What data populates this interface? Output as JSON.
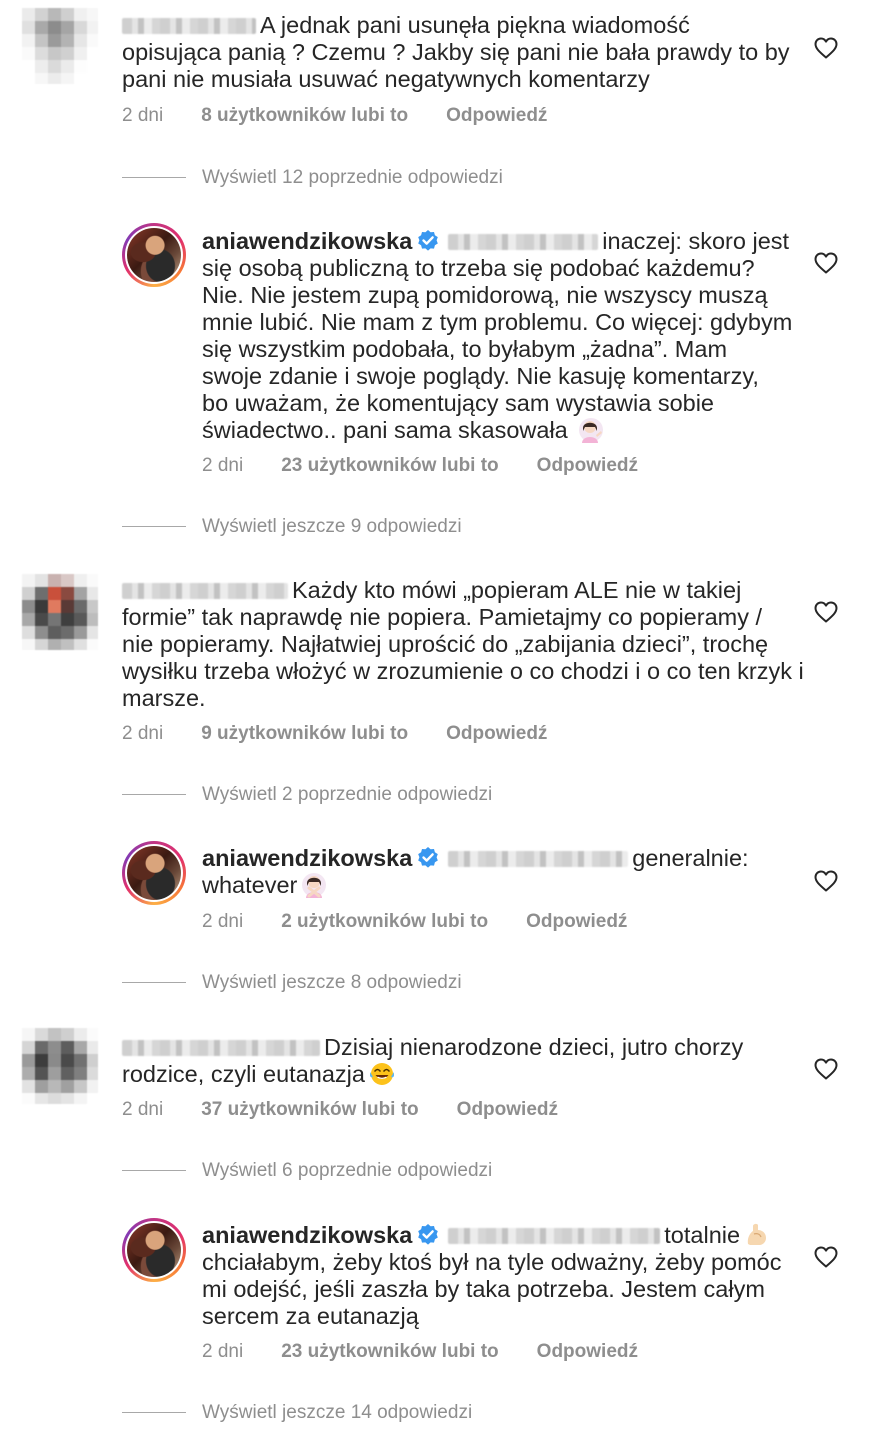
{
  "comments": [
    {
      "text": [
        "A jednak pani usunęła piękna wiadomość",
        "opisująca panią ? Czemu ? Jakby się pani nie bała prawdy to by",
        "pani nie musiała usuwać negatywnych komentarzy"
      ],
      "time": "2 dni",
      "likes": "8 użytkowników lubi to",
      "reply": "Odpowiedź",
      "view_replies": "Wyświetl 12 poprzednie odpowiedzi"
    },
    {
      "username": "aniawendzikowska",
      "text": [
        "inaczej: skoro jest",
        "się osobą publiczną to trzeba się podobać każdemu?",
        "Nie. Nie jestem zupą pomidorową, nie wszyscy muszą",
        "mnie lubić. Nie mam z tym problemu. Co więcej: gdybym",
        "się wszystkim podobała, to byłabym „żadna”. Mam",
        "swoje zdanie i swoje poglądy. Nie kasuję komentarzy,",
        "bo uważam, że komentujący sam wystawia sobie",
        "świadectwo.. pani sama skasowała"
      ],
      "emoji": "woman-tipping-hand-emoji",
      "time": "2 dni",
      "likes": "23 użytkowników lubi to",
      "reply": "Odpowiedź",
      "view_replies": "Wyświetl jeszcze 9 odpowiedzi"
    },
    {
      "text": [
        "Każdy kto mówi „popieram ALE nie w takiej",
        "formie” tak naprawdę nie popiera. Pamietajmy co popieramy /",
        "nie popieramy. Najłatwiej uprościć do „zabijania dzieci”, trochę",
        "wysiłku trzeba włożyć w zrozumienie o co chodzi i o co ten krzyk i",
        "marsze."
      ],
      "time": "2 dni",
      "likes": "9 użytkowników lubi to",
      "reply": "Odpowiedź",
      "view_replies": "Wyświetl 2 poprzednie odpowiedzi"
    },
    {
      "username": "aniawendzikowska",
      "text": [
        "generalnie:",
        "whatever"
      ],
      "emoji": "woman-gesturing-no-emoji",
      "time": "2 dni",
      "likes": "2 użytkowników lubi to",
      "reply": "Odpowiedź",
      "view_replies": "Wyświetl jeszcze 8 odpowiedzi"
    },
    {
      "text": [
        "Dzisiaj nienarodzone dzieci, jutro chorzy",
        "rodzice, czyli eutanazja"
      ],
      "emoji": "face-with-tears-of-joy-emoji",
      "time": "2 dni",
      "likes": "37 użytkowników lubi to",
      "reply": "Odpowiedź",
      "view_replies": "Wyświetl 6 poprzednie odpowiedzi"
    },
    {
      "username": "aniawendzikowska",
      "text": [
        "totalnie",
        "chciałabym, żeby ktoś był na tyle odważny, żeby pomóc",
        "mi odejść, jeśli zaszła by taka potrzeba. Jestem całym",
        "sercem za eutanazją"
      ],
      "emoji": "flexed-biceps-emoji",
      "time": "2 dni",
      "likes": "23 użytkowników lubi to",
      "reply": "Odpowiedź",
      "view_replies": "Wyświetl jeszcze 14 odpowiedzi"
    }
  ],
  "colors": {
    "text": "#262626",
    "meta": "#8e8e8e",
    "verified": "#3897f0",
    "heart": "#262626"
  }
}
